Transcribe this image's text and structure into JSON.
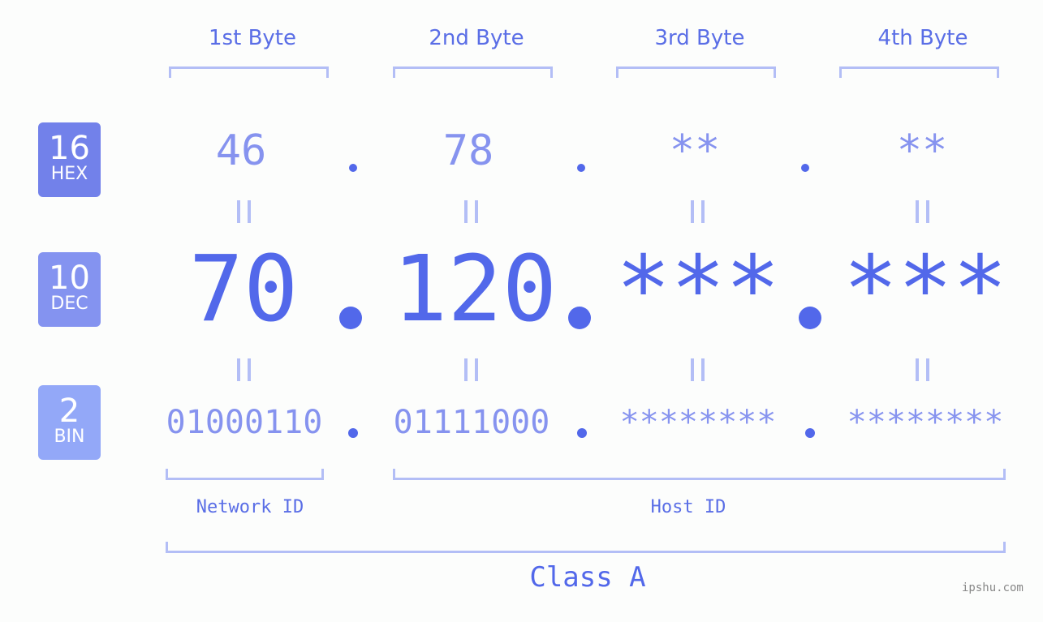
{
  "bytes": [
    {
      "header": "1st Byte",
      "hex": "46",
      "dec": "70",
      "bin": "01000110"
    },
    {
      "header": "2nd Byte",
      "hex": "78",
      "dec": "120",
      "bin": "01111000"
    },
    {
      "header": "3rd Byte",
      "hex": "**",
      "dec": "***",
      "bin": "********"
    },
    {
      "header": "4th Byte",
      "hex": "**",
      "dec": "***",
      "bin": "********"
    }
  ],
  "badges": {
    "hex": {
      "number": "16",
      "label": "HEX",
      "color": "#7281ea"
    },
    "dec": {
      "number": "10",
      "label": "DEC",
      "color": "#8493f0"
    },
    "bin": {
      "number": "2",
      "label": "BIN",
      "color": "#93a8f8"
    }
  },
  "separator": ".",
  "segments": {
    "network": "Network ID",
    "host": "Host ID"
  },
  "class_label": "Class A",
  "watermark": "ipshu.com",
  "colors": {
    "primary": "#5268ea",
    "secondary": "#8693ef",
    "bracket": "#b3bef6",
    "background": "#fcfdfc"
  }
}
